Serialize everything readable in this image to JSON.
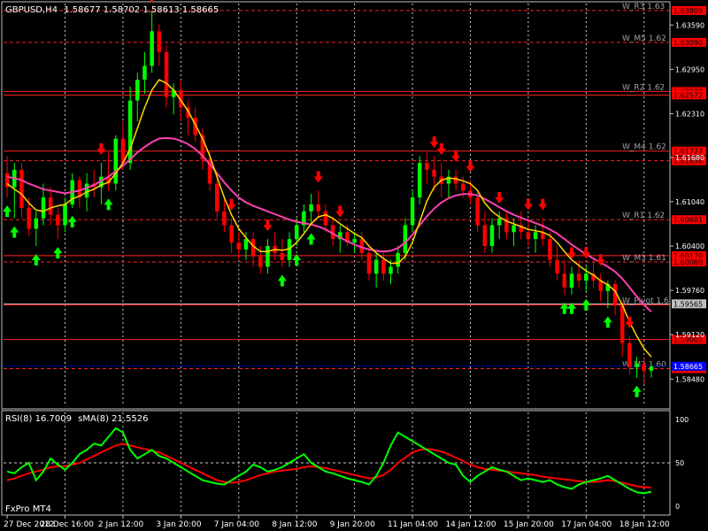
{
  "chart_data": {
    "type": "candlestick",
    "symbol": "GBPUSD,H4",
    "ohlc_header": "1.58677 1.58702 1.58613 1.58665",
    "watermark": "FxPro MT4",
    "colors": {
      "background": "#000000",
      "bull": "#00ff00",
      "bear": "#ff0000",
      "grid": "#ffffff",
      "ma_fast": "#ffd700",
      "ma_slow": "#ff40b0",
      "level_label_bg": "#ff0000",
      "current_price_bg": "#c0c0c0",
      "bid_line": "#0000ff"
    },
    "price_axis": {
      "ylim": [
        1.581,
        1.639
      ],
      "ticks": [
        "1.63590",
        "1.62950",
        "1.62310",
        "1.61680",
        "1.61040",
        "1.60400",
        "1.59760",
        "1.59120",
        "1.58480"
      ],
      "tick_values": [
        1.6359,
        1.6295,
        1.6231,
        1.6168,
        1.6104,
        1.604,
        1.5976,
        1.5912,
        1.5848
      ],
      "current_price": "1.59565",
      "current_price_value": 1.59565,
      "bid_price": "1.58665",
      "bid_price_value": 1.58665
    },
    "levels": [
      {
        "name": "W_R3 1.63",
        "value": 1.638,
        "label": "1.63809",
        "style": "dashed"
      },
      {
        "name": "W_M5 1.62",
        "value": 1.6334,
        "label": "1.63090",
        "style": "dashed"
      },
      {
        "name": "W_R2 1.62",
        "value": 1.6263,
        "label": "1.62588",
        "style": "solid"
      },
      {
        "name": "",
        "value": 1.6258,
        "label": "1.62572",
        "style": "solid"
      },
      {
        "name": "W_M4 1.62",
        "value": 1.6177,
        "label": "1.61727",
        "style": "solid"
      },
      {
        "name": "",
        "value": 1.6163,
        "label": "1.61636",
        "style": "dashed"
      },
      {
        "name": "W_R1 1.62",
        "value": 1.6078,
        "label": "1.60601",
        "style": "dashed"
      },
      {
        "name": "",
        "value": 1.6026,
        "label": "1.60170",
        "style": "solid"
      },
      {
        "name": "W_M3 1.61",
        "value": 1.6017,
        "label": "1.60060",
        "style": "dashed"
      },
      {
        "name": "W_Pivot 1.6",
        "value": 1.5955,
        "label": "",
        "style": "solid"
      },
      {
        "name": "",
        "value": 1.5905,
        "label": "1.59003",
        "style": "solid"
      },
      {
        "name": "W_M2 1.60",
        "value": 1.5863,
        "label": "1.58627",
        "style": "dashed"
      }
    ],
    "candles": [
      [
        1.6145,
        1.617,
        1.611,
        1.6125
      ],
      [
        1.6125,
        1.616,
        1.608,
        1.615
      ],
      [
        1.615,
        1.616,
        1.608,
        1.6095
      ],
      [
        1.6095,
        1.611,
        1.6055,
        1.6065
      ],
      [
        1.6065,
        1.609,
        1.604,
        1.608
      ],
      [
        1.608,
        1.613,
        1.607,
        1.611
      ],
      [
        1.611,
        1.6125,
        1.607,
        1.6085
      ],
      [
        1.6085,
        1.6095,
        1.605,
        1.607
      ],
      [
        1.607,
        1.611,
        1.606,
        1.61
      ],
      [
        1.61,
        1.6145,
        1.6095,
        1.6135
      ],
      [
        1.6135,
        1.614,
        1.6095,
        1.611
      ],
      [
        1.611,
        1.6145,
        1.609,
        1.613
      ],
      [
        1.613,
        1.615,
        1.611,
        1.6125
      ],
      [
        1.6125,
        1.616,
        1.61,
        1.614
      ],
      [
        1.614,
        1.6175,
        1.612,
        1.613
      ],
      [
        1.613,
        1.62,
        1.612,
        1.6195
      ],
      [
        1.6195,
        1.622,
        1.615,
        1.616
      ],
      [
        1.616,
        1.627,
        1.615,
        1.625
      ],
      [
        1.625,
        1.629,
        1.622,
        1.628
      ],
      [
        1.628,
        1.632,
        1.626,
        1.63
      ],
      [
        1.63,
        1.638,
        1.629,
        1.635
      ],
      [
        1.635,
        1.636,
        1.63,
        1.632
      ],
      [
        1.632,
        1.633,
        1.624,
        1.6255
      ],
      [
        1.6255,
        1.6275,
        1.623,
        1.6265
      ],
      [
        1.6265,
        1.628,
        1.622,
        1.624
      ],
      [
        1.624,
        1.625,
        1.62,
        1.6225
      ],
      [
        1.6225,
        1.624,
        1.619,
        1.62
      ],
      [
        1.62,
        1.621,
        1.615,
        1.6165
      ],
      [
        1.6165,
        1.6175,
        1.612,
        1.613
      ],
      [
        1.613,
        1.614,
        1.608,
        1.609
      ],
      [
        1.609,
        1.611,
        1.606,
        1.607
      ],
      [
        1.607,
        1.608,
        1.603,
        1.6045
      ],
      [
        1.6045,
        1.606,
        1.602,
        1.6035
      ],
      [
        1.6035,
        1.606,
        1.602,
        1.605
      ],
      [
        1.605,
        1.606,
        1.601,
        1.6025
      ],
      [
        1.6025,
        1.604,
        1.6,
        1.601
      ],
      [
        1.601,
        1.605,
        1.6,
        1.604
      ],
      [
        1.604,
        1.606,
        1.602,
        1.603
      ],
      [
        1.603,
        1.605,
        1.601,
        1.602
      ],
      [
        1.602,
        1.606,
        1.601,
        1.605
      ],
      [
        1.605,
        1.608,
        1.604,
        1.607
      ],
      [
        1.607,
        1.61,
        1.606,
        1.609
      ],
      [
        1.609,
        1.6115,
        1.607,
        1.61
      ],
      [
        1.61,
        1.612,
        1.608,
        1.609
      ],
      [
        1.609,
        1.61,
        1.606,
        1.607
      ],
      [
        1.607,
        1.608,
        1.604,
        1.605
      ],
      [
        1.605,
        1.607,
        1.603,
        1.606
      ],
      [
        1.606,
        1.607,
        1.604,
        1.6045
      ],
      [
        1.6045,
        1.606,
        1.603,
        1.605
      ],
      [
        1.605,
        1.606,
        1.602,
        1.603
      ],
      [
        1.603,
        1.604,
        1.599,
        1.6
      ],
      [
        1.6,
        1.603,
        1.598,
        1.602
      ],
      [
        1.602,
        1.603,
        1.599,
        1.6
      ],
      [
        1.6,
        1.602,
        1.5985,
        1.601
      ],
      [
        1.601,
        1.604,
        1.6,
        1.603
      ],
      [
        1.603,
        1.608,
        1.602,
        1.607
      ],
      [
        1.607,
        1.612,
        1.606,
        1.611
      ],
      [
        1.611,
        1.617,
        1.61,
        1.616
      ],
      [
        1.616,
        1.6175,
        1.613,
        1.615
      ],
      [
        1.615,
        1.617,
        1.612,
        1.614
      ],
      [
        1.614,
        1.616,
        1.611,
        1.613
      ],
      [
        1.613,
        1.615,
        1.611,
        1.614
      ],
      [
        1.614,
        1.615,
        1.612,
        1.613
      ],
      [
        1.613,
        1.614,
        1.611,
        1.612
      ],
      [
        1.612,
        1.6135,
        1.61,
        1.611
      ],
      [
        1.611,
        1.612,
        1.606,
        1.607
      ],
      [
        1.607,
        1.609,
        1.603,
        1.604
      ],
      [
        1.604,
        1.608,
        1.603,
        1.607
      ],
      [
        1.607,
        1.609,
        1.605,
        1.608
      ],
      [
        1.608,
        1.609,
        1.605,
        1.606
      ],
      [
        1.606,
        1.608,
        1.604,
        1.607
      ],
      [
        1.607,
        1.609,
        1.605,
        1.606
      ],
      [
        1.606,
        1.608,
        1.604,
        1.605
      ],
      [
        1.605,
        1.607,
        1.603,
        1.606
      ],
      [
        1.606,
        1.608,
        1.604,
        1.605
      ],
      [
        1.605,
        1.606,
        1.601,
        1.602
      ],
      [
        1.602,
        1.604,
        1.599,
        1.6
      ],
      [
        1.6,
        1.602,
        1.597,
        1.598
      ],
      [
        1.598,
        1.601,
        1.597,
        1.6
      ],
      [
        1.6,
        1.602,
        1.598,
        1.599
      ],
      [
        1.599,
        1.601,
        1.5975,
        1.6
      ],
      [
        1.6,
        1.602,
        1.598,
        1.599
      ],
      [
        1.599,
        1.6,
        1.596,
        1.5975
      ],
      [
        1.5975,
        1.599,
        1.595,
        1.5985
      ],
      [
        1.5985,
        1.599,
        1.594,
        1.5955
      ],
      [
        1.5955,
        1.596,
        1.588,
        1.59
      ],
      [
        1.59,
        1.591,
        1.5855,
        1.5865
      ],
      [
        1.5865,
        1.588,
        1.585,
        1.587
      ],
      [
        1.587,
        1.588,
        1.584,
        1.586
      ],
      [
        1.586,
        1.587,
        1.585,
        1.5866
      ]
    ],
    "ma_fast_values": [
      1.613,
      1.6122,
      1.6115,
      1.6102,
      1.6092,
      1.609,
      1.6095,
      1.6098,
      1.61,
      1.6108,
      1.6112,
      1.6118,
      1.6122,
      1.6128,
      1.6132,
      1.6145,
      1.616,
      1.618,
      1.621,
      1.624,
      1.6265,
      1.628,
      1.6275,
      1.6265,
      1.625,
      1.6235,
      1.6215,
      1.6195,
      1.617,
      1.614,
      1.611,
      1.6085,
      1.6065,
      1.6052,
      1.604,
      1.6032,
      1.6032,
      1.6035,
      1.6034,
      1.6036,
      1.6045,
      1.6058,
      1.6072,
      1.6082,
      1.6085,
      1.608,
      1.6072,
      1.6065,
      1.6058,
      1.6052,
      1.604,
      1.603,
      1.6022,
      1.6015,
      1.6015,
      1.6025,
      1.6045,
      1.6075,
      1.6105,
      1.6125,
      1.6135,
      1.6138,
      1.6137,
      1.6134,
      1.613,
      1.612,
      1.6102,
      1.609,
      1.6082,
      1.6076,
      1.6072,
      1.6068,
      1.6064,
      1.6062,
      1.606,
      1.6055,
      1.6045,
      1.6032,
      1.602,
      1.6012,
      1.6004,
      1.5998,
      1.599,
      1.5984,
      1.5975,
      1.5955,
      1.593,
      1.591,
      1.5892,
      1.588
    ],
    "ma_slow_values": [
      1.614,
      1.6138,
      1.6135,
      1.613,
      1.6126,
      1.6122,
      1.612,
      1.6118,
      1.6116,
      1.6118,
      1.612,
      1.6124,
      1.6128,
      1.6134,
      1.614,
      1.6148,
      1.6156,
      1.6165,
      1.6175,
      1.6183,
      1.619,
      1.6195,
      1.6196,
      1.6195,
      1.6192,
      1.6187,
      1.618,
      1.617,
      1.6158,
      1.6145,
      1.6132,
      1.612,
      1.611,
      1.6103,
      1.6098,
      1.6094,
      1.609,
      1.6086,
      1.6082,
      1.6078,
      1.6075,
      1.6073,
      1.6071,
      1.6068,
      1.6064,
      1.6058,
      1.6052,
      1.6047,
      1.6042,
      1.6038,
      1.6035,
      1.6033,
      1.6032,
      1.6033,
      1.6037,
      1.6045,
      1.6056,
      1.607,
      1.6083,
      1.6094,
      1.6103,
      1.6109,
      1.6113,
      1.6115,
      1.6115,
      1.6113,
      1.6108,
      1.6102,
      1.6096,
      1.609,
      1.6085,
      1.6081,
      1.6077,
      1.6073,
      1.6069,
      1.6064,
      1.6058,
      1.605,
      1.6042,
      1.6035,
      1.6028,
      1.6022,
      1.6016,
      1.601,
      1.6003,
      1.5993,
      1.598,
      1.5967,
      1.5955,
      1.5945
    ],
    "up_arrows": [
      0,
      1,
      4,
      7,
      9,
      14,
      38,
      40,
      42,
      77,
      78,
      80,
      83,
      87
    ],
    "down_arrows": [
      13,
      20,
      31,
      36,
      43,
      46,
      59,
      60,
      62,
      64,
      68,
      72,
      74,
      78,
      80,
      82,
      86
    ],
    "x_labels": [
      "27 Dec 2012",
      "28 Dec 16:00",
      "2 Jan 12:00",
      "3 Jan 20:00",
      "7 Jan 04:00",
      "8 Jan 12:00",
      "9 Jan 20:00",
      "11 Jan 04:00",
      "14 Jan 12:00",
      "15 Jan 20:00",
      "17 Jan 04:00",
      "18 Jan 12:00"
    ],
    "x_label_index": [
      0,
      8,
      16,
      24,
      32,
      40,
      48,
      56,
      64,
      72,
      80,
      88
    ],
    "rsi": {
      "label": "RSI(8) 16.7009",
      "ma_label": "sMA(8) 21.5526",
      "ylim": [
        0,
        100
      ],
      "ticks": [
        "100",
        "50",
        "0"
      ],
      "tick_values": [
        100,
        50,
        0
      ],
      "rsi_values": [
        40,
        38,
        45,
        50,
        30,
        40,
        55,
        48,
        42,
        50,
        60,
        65,
        72,
        70,
        80,
        90,
        85,
        65,
        55,
        60,
        65,
        58,
        55,
        50,
        45,
        40,
        35,
        30,
        28,
        26,
        25,
        30,
        35,
        40,
        48,
        45,
        40,
        42,
        45,
        50,
        55,
        60,
        50,
        45,
        40,
        38,
        35,
        32,
        30,
        28,
        25,
        35,
        50,
        70,
        85,
        80,
        75,
        70,
        65,
        60,
        55,
        50,
        48,
        35,
        28,
        35,
        40,
        45,
        42,
        40,
        35,
        30,
        32,
        30,
        28,
        30,
        25,
        22,
        20,
        25,
        28,
        30,
        32,
        35,
        30,
        25,
        20,
        16,
        15,
        16.7
      ],
      "ma_values": [
        30,
        32,
        35,
        38,
        40,
        42,
        45,
        46,
        46,
        48,
        50,
        54,
        58,
        62,
        66,
        70,
        72,
        70,
        68,
        66,
        64,
        62,
        58,
        54,
        50,
        46,
        42,
        38,
        34,
        30,
        28,
        27,
        28,
        30,
        33,
        36,
        38,
        40,
        41,
        42,
        43,
        45,
        46,
        45,
        44,
        42,
        40,
        38,
        36,
        34,
        32,
        33,
        36,
        42,
        50,
        56,
        62,
        65,
        66,
        65,
        63,
        60,
        56,
        52,
        48,
        45,
        43,
        42,
        41,
        40,
        39,
        38,
        37,
        36,
        34,
        33,
        32,
        31,
        30,
        29,
        28,
        28,
        29,
        30,
        29,
        27,
        25,
        23,
        22,
        21.55
      ]
    }
  }
}
